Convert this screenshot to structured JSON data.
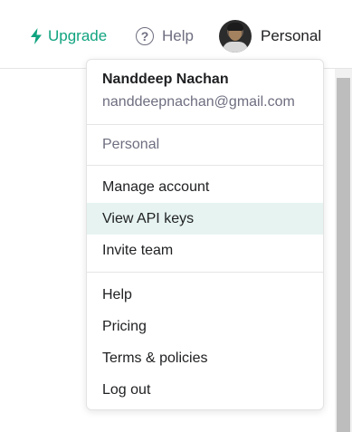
{
  "topbar": {
    "upgrade_label": "Upgrade",
    "help_label": "Help",
    "profile_label": "Personal"
  },
  "colors": {
    "accent": "#10a37f",
    "muted_text": "#6e6e80",
    "highlight": "#e6f3f1"
  },
  "account_menu": {
    "user_name": "Nanddeep Nachan",
    "user_email": "nanddeepnachan@gmail.com",
    "organization": "Personal",
    "account_items": [
      "Manage account",
      "View API keys",
      "Invite team"
    ],
    "active_item": "View API keys",
    "support_items": [
      "Help",
      "Pricing",
      "Terms & policies",
      "Log out"
    ]
  }
}
